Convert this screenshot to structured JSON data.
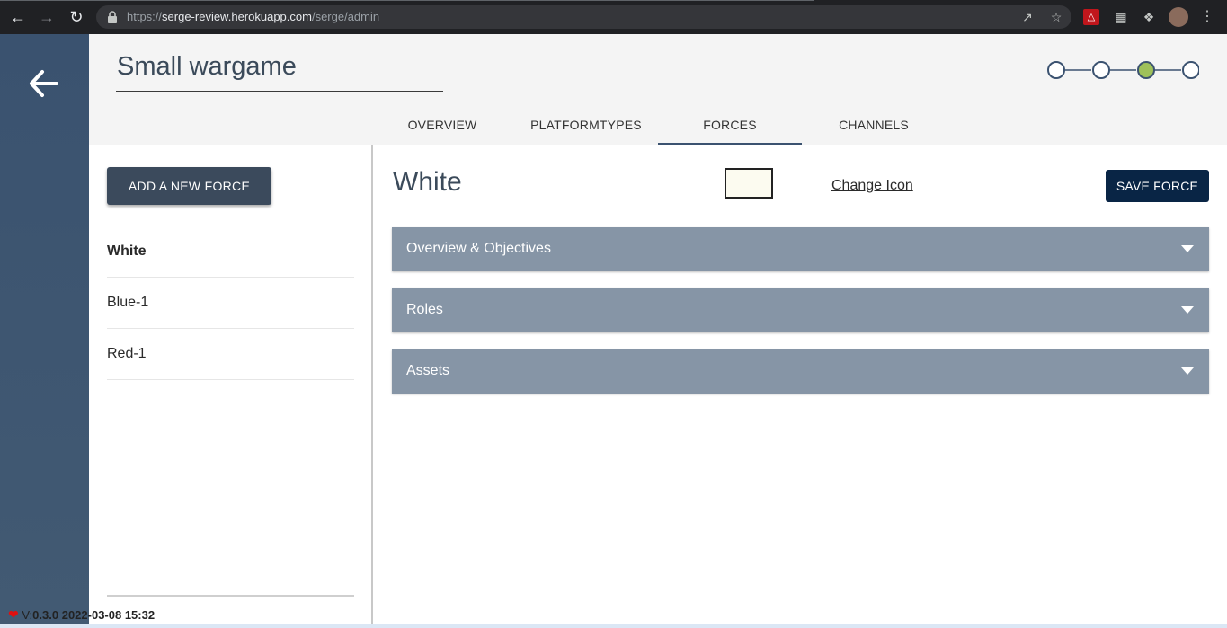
{
  "browser": {
    "url_scheme": "https://",
    "url_host": "serge-review.herokuapp.com",
    "url_path": "/serge/admin"
  },
  "header": {
    "game_title": "Small wargame",
    "stepper": {
      "steps": 4,
      "active_step": 3
    },
    "tabs": [
      {
        "label": "OVERVIEW",
        "active": false
      },
      {
        "label": "PLATFORMTYPES",
        "active": false
      },
      {
        "label": "FORCES",
        "active": true
      },
      {
        "label": "CHANNELS",
        "active": false
      }
    ]
  },
  "left_panel": {
    "add_force_label": "ADD A NEW FORCE",
    "forces": [
      {
        "name": "White",
        "selected": true
      },
      {
        "name": "Blue-1",
        "selected": false
      },
      {
        "name": "Red-1",
        "selected": false
      }
    ]
  },
  "right_panel": {
    "force_name": "White",
    "force_color": "#fcfbf0",
    "change_icon_label": "Change Icon",
    "save_label": "SAVE FORCE",
    "sections": [
      {
        "label": "Overview & Objectives"
      },
      {
        "label": "Roles"
      },
      {
        "label": "Assets"
      }
    ]
  },
  "footer": {
    "version_prefix": "V:",
    "version": "0.3.0",
    "build_date": "2022-03-08 15:32"
  },
  "colors": {
    "sidebar": "#3a526f",
    "primary_button": "#3b4a5c",
    "save_button": "#092545",
    "accordion": "#8695a6",
    "stepper_active": "#9fc15a"
  },
  "icons": [
    "back-arrow-icon",
    "forward-arrow-icon",
    "reload-icon",
    "lock-icon",
    "share-icon",
    "star-icon",
    "pdf-extension-icon",
    "extension-icon",
    "puzzle-icon",
    "profile-avatar-icon",
    "menu-dots-icon",
    "back-arrow-icon",
    "chevron-down-icon",
    "heart-icon"
  ]
}
